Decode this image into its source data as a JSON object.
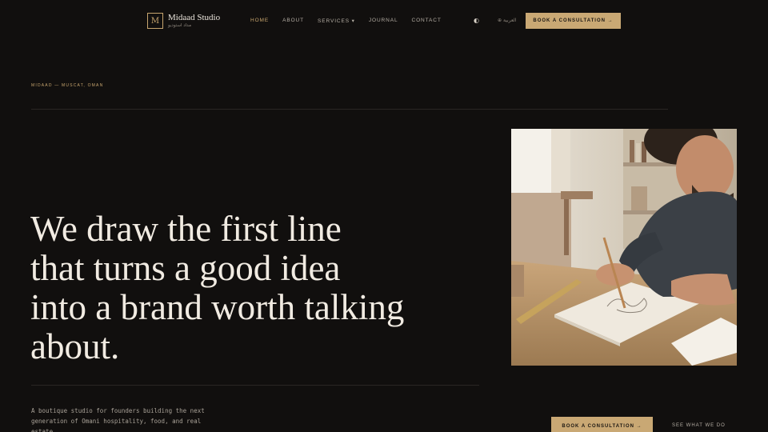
{
  "header": {
    "logo_mark": "M",
    "logo_name": "Midaad Studio",
    "logo_sub": "مداد استوديو",
    "nav": [
      {
        "label": "HOME",
        "active": true
      },
      {
        "label": "ABOUT"
      },
      {
        "label": "SERVICES ▾"
      },
      {
        "label": "JOURNAL"
      },
      {
        "label": "CONTACT"
      }
    ],
    "theme_icon": "◐",
    "lang_label": "⊕ العربية",
    "cta_label": "BOOK A CONSULTATION →"
  },
  "hero": {
    "eyebrow": "MIDAAD — MUSCAT, OMAN",
    "headline_lines": [
      "We draw the first line",
      "that turns a good idea",
      "into a brand worth talking",
      "about."
    ],
    "description": "A boutique studio for founders building the next generation of Omani hospitality, food, and real estate.",
    "cta_label": "BOOK A CONSULTATION →",
    "secondary_label": "SEE WHAT WE DO",
    "image_icon": "photo-designer-sketching"
  },
  "colors": {
    "background": "#110f0e",
    "accent": "#c9a874",
    "text": "#f1ebe2"
  }
}
